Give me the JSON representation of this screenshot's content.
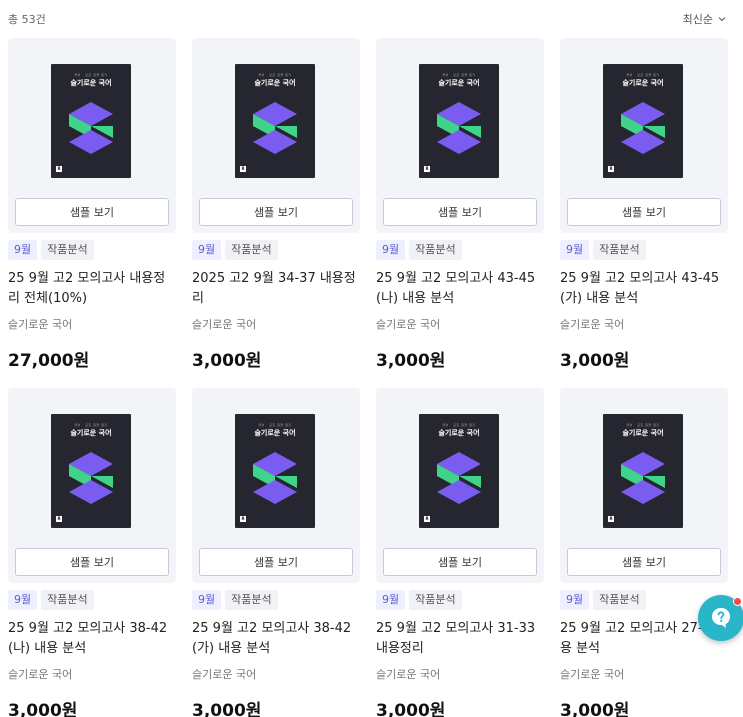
{
  "header": {
    "total_label": "총 53건",
    "sort_label": "최신순"
  },
  "cover": {
    "tagline": "국어 · 모든 글을 읽기",
    "title": "슬기로운 국어",
    "publisher_mark": "R",
    "colors": {
      "purple": "#7b5cf0",
      "green": "#3fd48a",
      "bg": "#25262f"
    }
  },
  "products": [
    {
      "month": "9월",
      "category": "작품분석",
      "title": "25 9월 고2 모의고사 내용정리 전체(10%)",
      "author": "슬기로운 국어",
      "price": "27,000원",
      "sample_label": "샘플 보기"
    },
    {
      "month": "9월",
      "category": "작품분석",
      "title": "2025 고2 9월 34-37 내용정리",
      "author": "슬기로운 국어",
      "price": "3,000원",
      "sample_label": "샘플 보기"
    },
    {
      "month": "9월",
      "category": "작품분석",
      "title": "25 9월 고2 모의고사 43-45 (나) 내용 분석",
      "author": "슬기로운 국어",
      "price": "3,000원",
      "sample_label": "샘플 보기"
    },
    {
      "month": "9월",
      "category": "작품분석",
      "title": "25 9월 고2 모의고사 43-45 (가) 내용 분석",
      "author": "슬기로운 국어",
      "price": "3,000원",
      "sample_label": "샘플 보기"
    },
    {
      "month": "9월",
      "category": "작품분석",
      "title": "25 9월 고2 모의고사 38-42 (나) 내용 분석",
      "author": "슬기로운 국어",
      "price": "3,000원",
      "sample_label": "샘플 보기"
    },
    {
      "month": "9월",
      "category": "작품분석",
      "title": "25 9월 고2 모의고사 38-42 (가) 내용 분석",
      "author": "슬기로운 국어",
      "price": "3,000원",
      "sample_label": "샘플 보기"
    },
    {
      "month": "9월",
      "category": "작품분석",
      "title": "25 9월 고2 모의고사 31-33 내용정리",
      "author": "슬기로운 국어",
      "price": "3,000원",
      "sample_label": "샘플 보기"
    },
    {
      "month": "9월",
      "category": "작품분석",
      "title": "25 9월 고2 모의고사 27- 내용 분석",
      "author": "슬기로운 국어",
      "price": "3,000원",
      "sample_label": "샘플 보기"
    }
  ],
  "chat_button": {
    "icon": "chat-question-icon",
    "color": "#29b6c8",
    "badge_color": "#f2494c"
  }
}
